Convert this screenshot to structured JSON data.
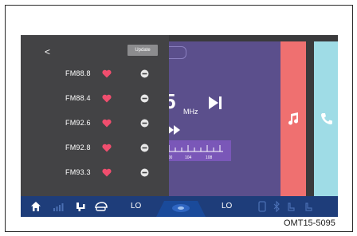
{
  "back_label": "<",
  "update_label": "Update",
  "favorites": [
    {
      "label": "FM88.8",
      "heart": "heart-icon",
      "remove": "minus-circle-icon"
    },
    {
      "label": "FM88.4",
      "heart": "heart-icon",
      "remove": "minus-circle-icon"
    },
    {
      "label": "FM92.6",
      "heart": "heart-icon",
      "remove": "minus-circle-icon"
    },
    {
      "label": "FM92.8",
      "heart": "heart-icon",
      "remove": "minus-circle-icon"
    },
    {
      "label": "FM93.3",
      "heart": "heart-icon",
      "remove": "minus-circle-icon"
    }
  ],
  "radio": {
    "frequency_digit": "5",
    "unit": "MHz",
    "tuner_ticks": [
      "100",
      "104",
      "108"
    ]
  },
  "tiles": {
    "music_icon": "music-note-icon",
    "phone_icon": "phone-icon"
  },
  "status_bar": {
    "left_temp": "LO",
    "right_temp": "LO",
    "icons": [
      "home-icon",
      "signal-icon",
      "seat-icon",
      "recirculation-icon",
      "fan-icon",
      "phone-status-icon",
      "bluetooth-icon",
      "seat-heat-left-icon",
      "seat-heat-right-icon"
    ]
  },
  "colors": {
    "radio_panel": "#5b4f8c",
    "tuner": "#7a57b8",
    "music_tile": "#ef7070",
    "phone_tile": "#9fdce6",
    "heart": "#f04e6e",
    "status_bar": "#1e3d7a"
  },
  "figure_code": "OMT15-5095"
}
